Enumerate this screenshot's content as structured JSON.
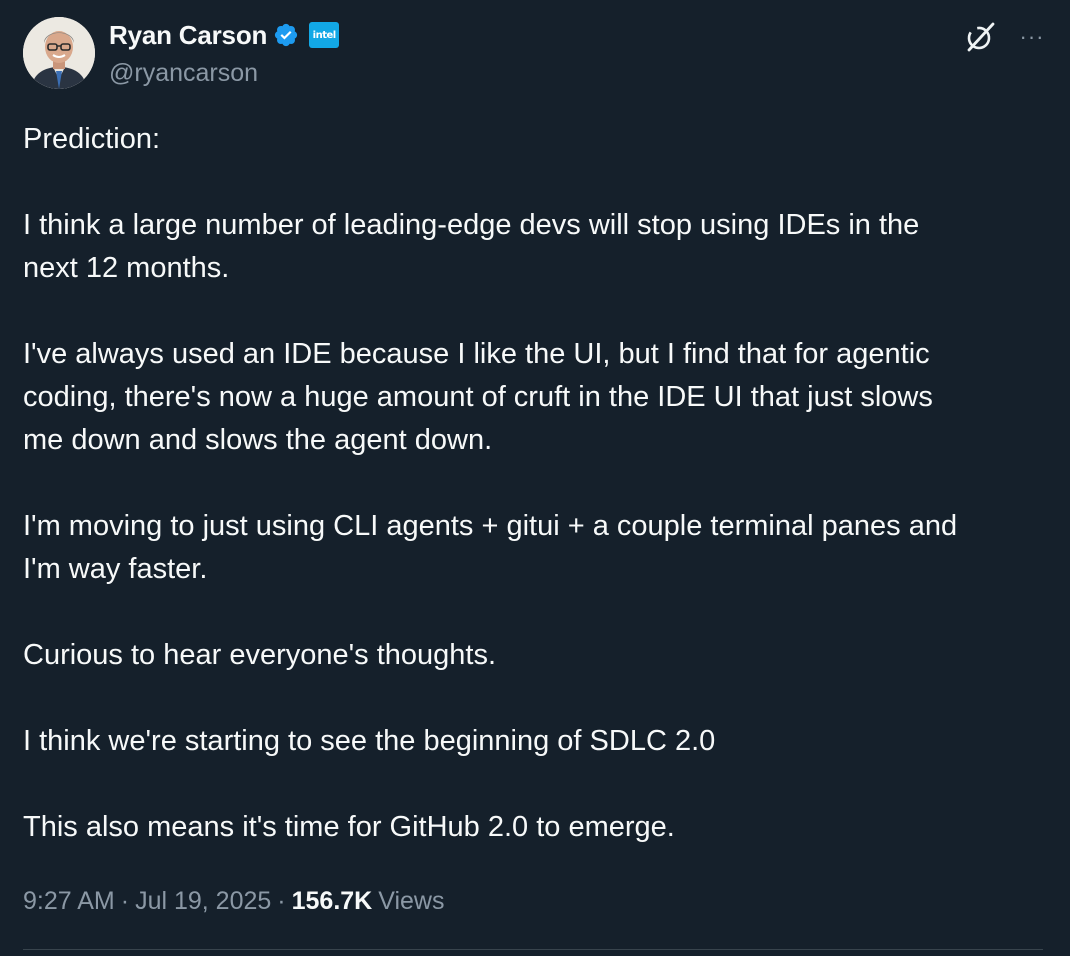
{
  "author": {
    "display_name": "Ryan Carson",
    "handle": "@ryancarson",
    "verified": true,
    "affiliate_badge": "intel",
    "avatar_icon": "profile-photo"
  },
  "actions": {
    "grok_icon": "grok-icon",
    "more_icon": "more-icon",
    "more_label": "···"
  },
  "tweet": {
    "paragraphs": [
      "Prediction:",
      "I think a large number of leading-edge devs will stop using IDEs in the\nnext 12 months.",
      "I've always used an IDE because I like the UI, but I find that for agentic\ncoding, there's now a huge amount of cruft in the IDE UI that just slows\nme down and slows the agent down.",
      "I'm moving to just using CLI agents + gitui + a couple terminal panes and\nI'm way faster.",
      "Curious to hear everyone's thoughts.",
      "I think we're starting to see the beginning of SDLC 2.0",
      "This also means it's time for GitHub 2.0 to emerge."
    ]
  },
  "meta": {
    "time": "9:27 AM",
    "date": "Jul 19, 2025",
    "separator": "·",
    "views_count": "156.7K",
    "views_label": "Views"
  },
  "colors": {
    "background": "#15202b",
    "text": "#f7f9f9",
    "secondary": "#8b98a5",
    "verified_blue": "#1d9bf0",
    "intel_blue": "#12a8e6",
    "divider": "#38444d"
  }
}
